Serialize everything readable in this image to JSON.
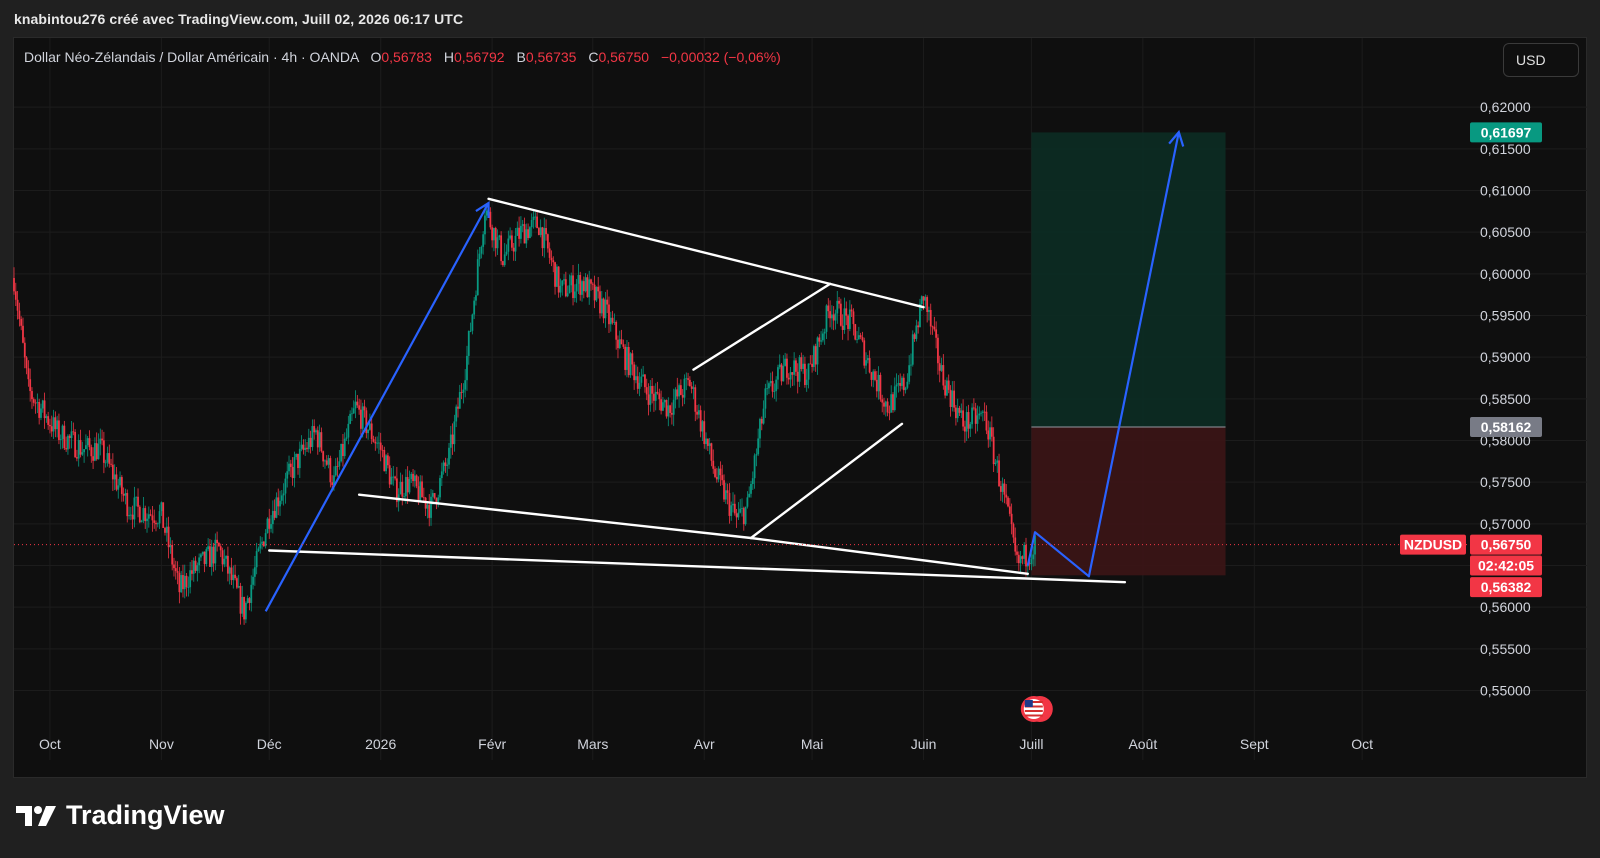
{
  "header": {
    "credit": "knabintou276 créé avec TradingView.com, Juill 02, 2026 06:17 UTC"
  },
  "legend": {
    "symbol_desc": "Dollar Néo-Zélandais / Dollar Américain · 4h · OANDA",
    "open_label": "O",
    "open_value": "0,56783",
    "high_label": "H",
    "high_value": "0,56792",
    "low_label": "B",
    "low_value": "0,56735",
    "close_label": "C",
    "close_value": "0,56750",
    "change_value": "−0,00032 (−0,06%)"
  },
  "currency_button": "USD",
  "brand": {
    "name": "TradingView"
  },
  "colors": {
    "up": "#089981",
    "down": "#f23645",
    "projection": "#2962ff",
    "pattern": "#ffffff",
    "target_bg": "#0d2b23",
    "stop_bg": "#3a1516"
  },
  "chart_data": {
    "type": "candlestick",
    "symbol": "NZDUSD",
    "interval": "4h",
    "y_axis_ticks": [
      "0,62000",
      "0,61500",
      "0,61000",
      "0,60500",
      "0,60000",
      "0,59500",
      "0,59000",
      "0,58500",
      "0,58000",
      "0,57500",
      "0,57000",
      "0,56500",
      "0,56000",
      "0,55500",
      "0,55000"
    ],
    "y_tick_values": [
      0.62,
      0.615,
      0.61,
      0.605,
      0.6,
      0.595,
      0.59,
      0.585,
      0.58,
      0.575,
      0.57,
      0.565,
      0.56,
      0.555,
      0.55
    ],
    "x_axis_labels": [
      "Oct",
      "Nov",
      "Déc",
      "2026",
      "Févr",
      "Mars",
      "Avr",
      "Mai",
      "Juin",
      "Juill",
      "Août",
      "Sept",
      "Oct"
    ],
    "x_label_dates": [
      "2025-10-01",
      "2025-11-01",
      "2025-12-01",
      "2026-01-01",
      "2026-02-01",
      "2026-03-01",
      "2026-04-01",
      "2026-05-01",
      "2026-06-01",
      "2026-07-01",
      "2026-08-01",
      "2026-09-01",
      "2026-10-01"
    ],
    "ylim": [
      0.5455,
      0.6283
    ],
    "xlim": [
      "2025-09-21",
      "2026-10-31"
    ],
    "price_path": [
      {
        "x": "2025-09-21",
        "y": 0.5995
      },
      {
        "x": "2025-09-25",
        "y": 0.586
      },
      {
        "x": "2025-10-03",
        "y": 0.581
      },
      {
        "x": "2025-10-10",
        "y": 0.579
      },
      {
        "x": "2025-10-15",
        "y": 0.579
      },
      {
        "x": "2025-10-23",
        "y": 0.572
      },
      {
        "x": "2025-11-01",
        "y": 0.571
      },
      {
        "x": "2025-11-06",
        "y": 0.562
      },
      {
        "x": "2025-11-09",
        "y": 0.564
      },
      {
        "x": "2025-11-17",
        "y": 0.567
      },
      {
        "x": "2025-11-24",
        "y": 0.5595
      },
      {
        "x": "2025-12-01",
        "y": 0.571
      },
      {
        "x": "2025-12-08",
        "y": 0.577
      },
      {
        "x": "2025-12-14",
        "y": 0.581
      },
      {
        "x": "2025-12-19",
        "y": 0.575
      },
      {
        "x": "2025-12-25",
        "y": 0.584
      },
      {
        "x": "2026-01-01",
        "y": 0.579
      },
      {
        "x": "2026-01-05",
        "y": 0.574
      },
      {
        "x": "2026-01-09",
        "y": 0.575
      },
      {
        "x": "2026-01-15",
        "y": 0.572
      },
      {
        "x": "2026-01-20",
        "y": 0.578
      },
      {
        "x": "2026-01-25",
        "y": 0.59
      },
      {
        "x": "2026-01-30",
        "y": 0.608
      },
      {
        "x": "2026-02-04",
        "y": 0.602
      },
      {
        "x": "2026-02-09",
        "y": 0.605
      },
      {
        "x": "2026-02-14",
        "y": 0.606
      },
      {
        "x": "2026-02-20",
        "y": 0.598
      },
      {
        "x": "2026-02-26",
        "y": 0.599
      },
      {
        "x": "2026-03-04",
        "y": 0.596
      },
      {
        "x": "2026-03-10",
        "y": 0.59
      },
      {
        "x": "2026-03-16",
        "y": 0.586
      },
      {
        "x": "2026-03-22",
        "y": 0.584
      },
      {
        "x": "2026-03-28",
        "y": 0.587
      },
      {
        "x": "2026-04-04",
        "y": 0.576
      },
      {
        "x": "2026-04-10",
        "y": 0.5705
      },
      {
        "x": "2026-04-13",
        "y": 0.572
      },
      {
        "x": "2026-04-18",
        "y": 0.585
      },
      {
        "x": "2026-04-24",
        "y": 0.589
      },
      {
        "x": "2026-04-30",
        "y": 0.588
      },
      {
        "x": "2026-05-06",
        "y": 0.596
      },
      {
        "x": "2026-05-12",
        "y": 0.594
      },
      {
        "x": "2026-05-17",
        "y": 0.589
      },
      {
        "x": "2026-05-22",
        "y": 0.584
      },
      {
        "x": "2026-05-27",
        "y": 0.587
      },
      {
        "x": "2026-06-01",
        "y": 0.5975
      },
      {
        "x": "2026-06-06",
        "y": 0.588
      },
      {
        "x": "2026-06-12",
        "y": 0.582
      },
      {
        "x": "2026-06-18",
        "y": 0.583
      },
      {
        "x": "2026-06-24",
        "y": 0.572
      },
      {
        "x": "2026-06-27",
        "y": 0.565
      },
      {
        "x": "2026-06-30",
        "y": 0.5665
      },
      {
        "x": "2026-07-02",
        "y": 0.5675
      }
    ],
    "pattern_lines": [
      {
        "name": "upper-wedge-line",
        "points": [
          {
            "x": "2026-01-31",
            "y": 0.609
          },
          {
            "x": "2026-06-01",
            "y": 0.596
          }
        ]
      },
      {
        "name": "middle-wedge-line",
        "points": [
          {
            "x": "2025-12-26",
            "y": 0.5735
          },
          {
            "x": "2026-04-14",
            "y": 0.5683
          }
        ]
      },
      {
        "name": "lower-wedge-line",
        "points": [
          {
            "x": "2026-04-14",
            "y": 0.5683
          },
          {
            "x": "2026-06-30",
            "y": 0.564
          }
        ]
      },
      {
        "name": "bottom-support-line",
        "points": [
          {
            "x": "2025-12-01",
            "y": 0.5668
          },
          {
            "x": "2026-07-27",
            "y": 0.563
          }
        ]
      },
      {
        "name": "channel-upper-line",
        "points": [
          {
            "x": "2026-03-29",
            "y": 0.5885
          },
          {
            "x": "2026-05-06",
            "y": 0.5988
          }
        ]
      },
      {
        "name": "channel-lower-line",
        "points": [
          {
            "x": "2026-04-14",
            "y": 0.5683
          },
          {
            "x": "2026-05-26",
            "y": 0.582
          }
        ]
      }
    ],
    "projection_paths": [
      {
        "name": "projection-past-rally",
        "points": [
          {
            "x": "2025-11-30",
            "y": 0.5595
          },
          {
            "x": "2026-01-31",
            "y": 0.6085
          }
        ]
      },
      {
        "name": "projection-future",
        "points": [
          {
            "x": "2026-06-30",
            "y": 0.565
          },
          {
            "x": "2026-07-02",
            "y": 0.569
          },
          {
            "x": "2026-07-17",
            "y": 0.5637
          },
          {
            "x": "2026-08-11",
            "y": 0.617
          }
        ]
      }
    ],
    "position": {
      "entry": 0.58162,
      "target": 0.61697,
      "stop": 0.56382,
      "start": "2026-07-01",
      "end": "2026-08-24"
    },
    "price_tags": [
      {
        "label": "0,61697",
        "value": 0.61697,
        "bg": "#089981",
        "fg": "#ffffff"
      },
      {
        "label": "0,58162",
        "value": 0.58162,
        "bg": "#787b86",
        "fg": "#ffffff"
      },
      {
        "label": "0,56750",
        "value": 0.5675,
        "bg": "#f23645",
        "fg": "#ffffff"
      },
      {
        "label": "02:42:05",
        "value": 0.565,
        "bg": "#f23645",
        "fg": "#ffffff"
      },
      {
        "label": "0,56382",
        "value": 0.5624,
        "bg": "#f23645",
        "fg": "#ffffff"
      }
    ],
    "symbol_tag": {
      "label": "NZDUSD",
      "value": 0.5675
    },
    "current_price": 0.5675,
    "grid": true
  }
}
